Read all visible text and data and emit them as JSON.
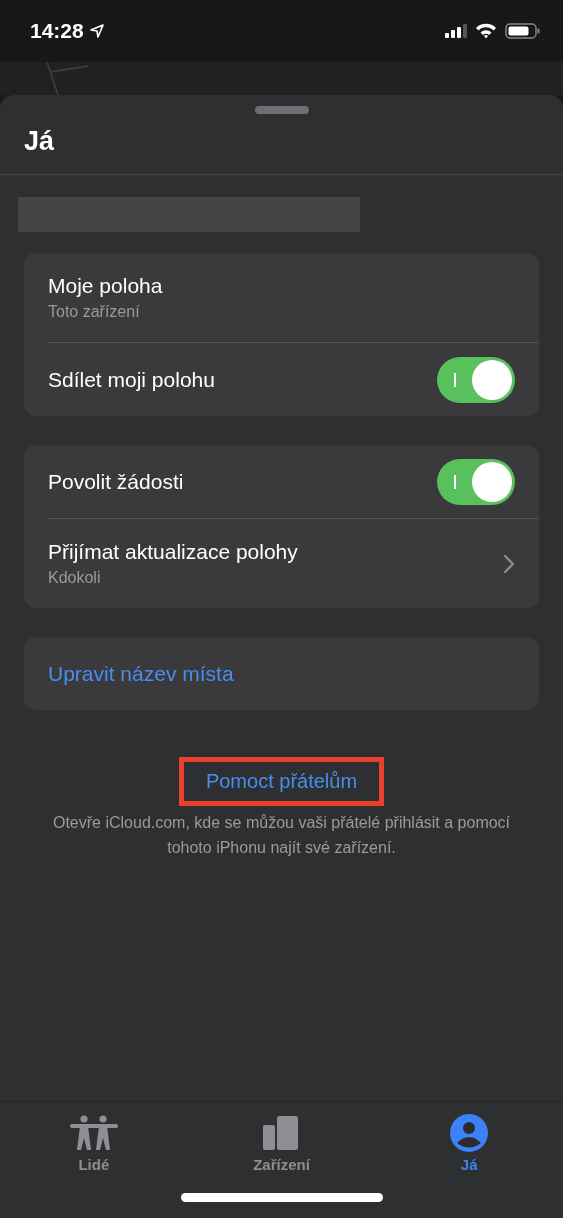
{
  "status_bar": {
    "time": "14:28"
  },
  "sheet": {
    "title": "Já"
  },
  "groups": [
    {
      "rows": [
        {
          "kind": "detail",
          "label": "Moje poloha",
          "subtitle": "Toto zařízení"
        },
        {
          "kind": "toggle",
          "label": "Sdílet moji polohu",
          "on": true
        }
      ]
    },
    {
      "rows": [
        {
          "kind": "toggle",
          "label": "Povolit žádosti",
          "on": true
        },
        {
          "kind": "chevron",
          "label": "Přijímat aktualizace polohy",
          "subtitle": "Kdokoli"
        }
      ]
    },
    {
      "rows": [
        {
          "kind": "action",
          "label": "Upravit název místa"
        }
      ]
    }
  ],
  "help": {
    "link": "Pomoct přátelům",
    "highlighted": true,
    "description": "Otevře iCloud.com, kde se můžou vaši přátelé přihlásit a pomocí tohoto iPhonu najít své zařízení."
  },
  "tabs": [
    {
      "kind": "people",
      "label": "Lidé",
      "selected": false
    },
    {
      "kind": "devices",
      "label": "Zařízení",
      "selected": false
    },
    {
      "kind": "me",
      "label": "Já",
      "selected": true
    }
  ]
}
